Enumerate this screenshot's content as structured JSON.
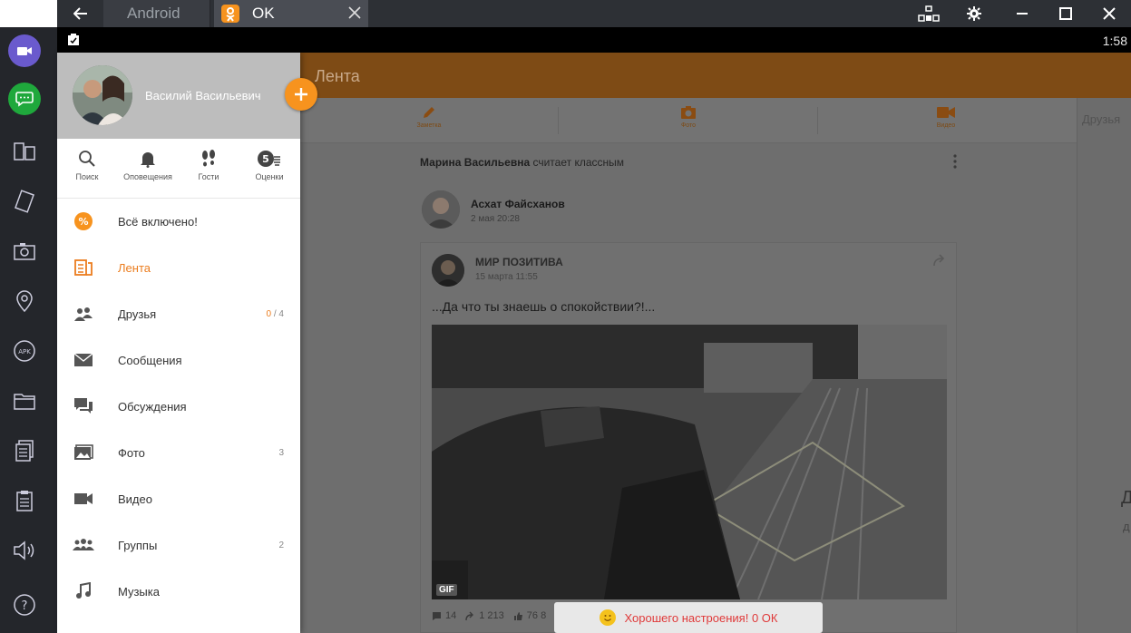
{
  "titlebar": {
    "tabs": [
      {
        "label": "Android"
      },
      {
        "label": "OK"
      }
    ]
  },
  "statusbar": {
    "time": "1:58"
  },
  "drawer": {
    "profile_name": "Василий Васильевич",
    "quick": [
      {
        "label": "Поиск",
        "icon": "search-icon"
      },
      {
        "label": "Оповещения",
        "icon": "bell-icon"
      },
      {
        "label": "Гости",
        "icon": "footprints-icon"
      },
      {
        "label": "Оценки",
        "icon": "ratings-icon"
      }
    ],
    "menu": [
      {
        "label": "Всё включено!",
        "count": "",
        "icon": "all-inclusive-icon"
      },
      {
        "label": "Лента",
        "count": "",
        "icon": "feed-icon",
        "active": true
      },
      {
        "label": "Друзья",
        "count_new": "0",
        "count_rest": " / 4",
        "icon": "friends-icon"
      },
      {
        "label": "Сообщения",
        "count": "",
        "icon": "messages-icon"
      },
      {
        "label": "Обсуждения",
        "count": "",
        "icon": "discussions-icon"
      },
      {
        "label": "Фото",
        "count": "3",
        "icon": "photo-icon"
      },
      {
        "label": "Видео",
        "count": "",
        "icon": "video-icon"
      },
      {
        "label": "Группы",
        "count": "2",
        "icon": "groups-icon"
      },
      {
        "label": "Музыка",
        "count": "",
        "icon": "music-icon"
      }
    ]
  },
  "appbar": {
    "title": "Лента"
  },
  "actions": [
    {
      "label": "Заметка",
      "icon": "pencil-icon"
    },
    {
      "label": "Фото",
      "icon": "camera-icon"
    },
    {
      "label": "Видео",
      "icon": "video-camera-icon"
    }
  ],
  "right_column": {
    "label": "Друзья",
    "letter_big": "Д",
    "letter_small": "д"
  },
  "feed": {
    "header_name": "Марина Васильевна",
    "header_rest": " считает классным",
    "author_name": "Асхат Файсханов",
    "author_date": "2 мая 20:28",
    "group_name": "МИР ПОЗИТИВА",
    "group_date": "15 марта 11:55",
    "post_text": "...Да что ты знаешь о спокойствии?!...",
    "gif_label": "GIF",
    "stats": {
      "comments": "14",
      "reshares": "1 213",
      "likes": "76 8"
    }
  },
  "toast": {
    "text": "Хорошего настроения! 0 ОК"
  },
  "colors": {
    "accent": "#f7931e",
    "appbar_dimmed": "#7e4b15",
    "toast_text": "#e03a3a"
  }
}
